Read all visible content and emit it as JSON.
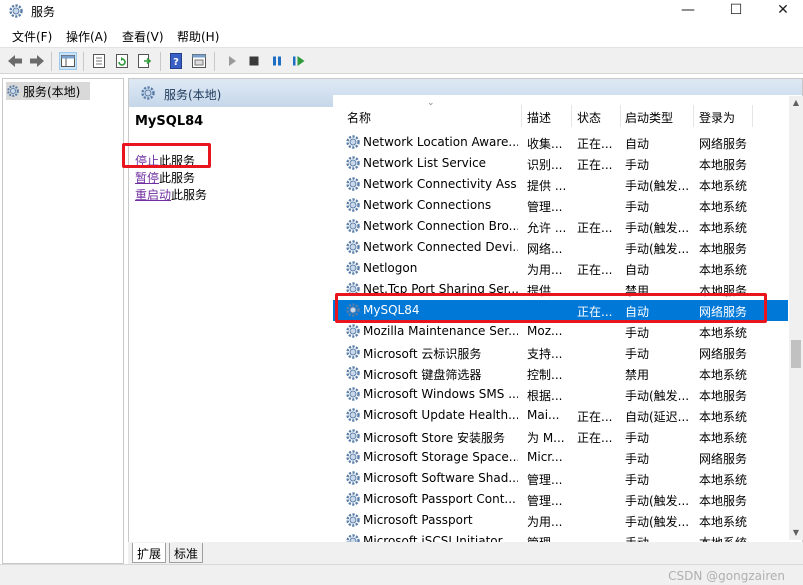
{
  "window": {
    "title": "服务",
    "minimize": "—",
    "maximize": "☐",
    "close": "✕"
  },
  "menu": {
    "items": [
      "文件(F)",
      "操作(A)",
      "查看(V)",
      "帮助(H)"
    ]
  },
  "toolbar": {
    "icons": [
      "back-icon",
      "forward-icon",
      "show-tree-icon",
      "properties-icon",
      "refresh-icon",
      "export-icon",
      "help-icon",
      "view-icon",
      "start-icon",
      "stop-icon",
      "pause-icon",
      "restart-icon"
    ]
  },
  "tree": {
    "root_label": "服务(本地)"
  },
  "right_header": {
    "label": "服务(本地)"
  },
  "extended": {
    "service_name": "MySQL84",
    "stop_link": {
      "u": "停止",
      "rest": "此服务"
    },
    "pause_link": {
      "u": "暂停",
      "rest": "此服务"
    },
    "restart_link": {
      "u": "重启动",
      "rest": "此服务"
    }
  },
  "list": {
    "columns": [
      "名称",
      "描述",
      "状态",
      "启动类型",
      "登录为"
    ],
    "sort_indicator": "⌄",
    "rows": [
      {
        "name": "Network Location Aware...",
        "desc": "收集...",
        "status": "正在...",
        "startup": "自动",
        "logon": "网络服务",
        "selected": false
      },
      {
        "name": "Network List Service",
        "desc": "识别...",
        "status": "正在...",
        "startup": "手动",
        "logon": "本地服务",
        "selected": false
      },
      {
        "name": "Network Connectivity Ass...",
        "desc": "提供 ...",
        "status": "",
        "startup": "手动(触发...",
        "logon": "本地系统",
        "selected": false
      },
      {
        "name": "Network Connections",
        "desc": "管理...",
        "status": "",
        "startup": "手动",
        "logon": "本地系统",
        "selected": false
      },
      {
        "name": "Network Connection Bro...",
        "desc": "允许 ...",
        "status": "正在...",
        "startup": "手动(触发...",
        "logon": "本地系统",
        "selected": false
      },
      {
        "name": "Network Connected Devi...",
        "desc": "网络...",
        "status": "",
        "startup": "手动(触发...",
        "logon": "本地服务",
        "selected": false
      },
      {
        "name": "Netlogon",
        "desc": "为用...",
        "status": "正在...",
        "startup": "自动",
        "logon": "本地系统",
        "selected": false
      },
      {
        "name": "Net.Tcp Port Sharing Ser...",
        "desc": "提供...",
        "status": "",
        "startup": "禁用",
        "logon": "本地服务",
        "selected": false
      },
      {
        "name": "MySQL84",
        "desc": "",
        "status": "正在...",
        "startup": "自动",
        "logon": "网络服务",
        "selected": true
      },
      {
        "name": "Mozilla Maintenance Ser...",
        "desc": "Moz...",
        "status": "",
        "startup": "手动",
        "logon": "本地系统",
        "selected": false
      },
      {
        "name": "Microsoft 云标识服务",
        "desc": "支持...",
        "status": "",
        "startup": "手动",
        "logon": "网络服务",
        "selected": false
      },
      {
        "name": "Microsoft 键盘筛选器",
        "desc": "控制...",
        "status": "",
        "startup": "禁用",
        "logon": "本地系统",
        "selected": false
      },
      {
        "name": "Microsoft Windows SMS ...",
        "desc": "根据...",
        "status": "",
        "startup": "手动(触发...",
        "logon": "本地服务",
        "selected": false
      },
      {
        "name": "Microsoft Update Health...",
        "desc": "Mai...",
        "status": "正在...",
        "startup": "自动(延迟...",
        "logon": "本地系统",
        "selected": false
      },
      {
        "name": "Microsoft Store 安装服务",
        "desc": "为 M...",
        "status": "正在...",
        "startup": "手动",
        "logon": "本地系统",
        "selected": false
      },
      {
        "name": "Microsoft Storage Space...",
        "desc": "Micr...",
        "status": "",
        "startup": "手动",
        "logon": "网络服务",
        "selected": false
      },
      {
        "name": "Microsoft Software Shad...",
        "desc": "管理...",
        "status": "",
        "startup": "手动",
        "logon": "本地系统",
        "selected": false
      },
      {
        "name": "Microsoft Passport Cont...",
        "desc": "管理...",
        "status": "",
        "startup": "手动(触发...",
        "logon": "本地服务",
        "selected": false
      },
      {
        "name": "Microsoft Passport",
        "desc": "为用...",
        "status": "",
        "startup": "手动(触发...",
        "logon": "本地系统",
        "selected": false
      },
      {
        "name": "Microsoft iSCSI Initiator...",
        "desc": "管理...",
        "status": "",
        "startup": "手动",
        "logon": "本地系统",
        "selected": false
      }
    ]
  },
  "tabs": [
    "扩展",
    "标准"
  ],
  "watermark": "CSDN @gongzairen",
  "colors": {
    "selection": "#0078d7",
    "highlight_box": "#e8141e",
    "link": "#7030a0"
  }
}
